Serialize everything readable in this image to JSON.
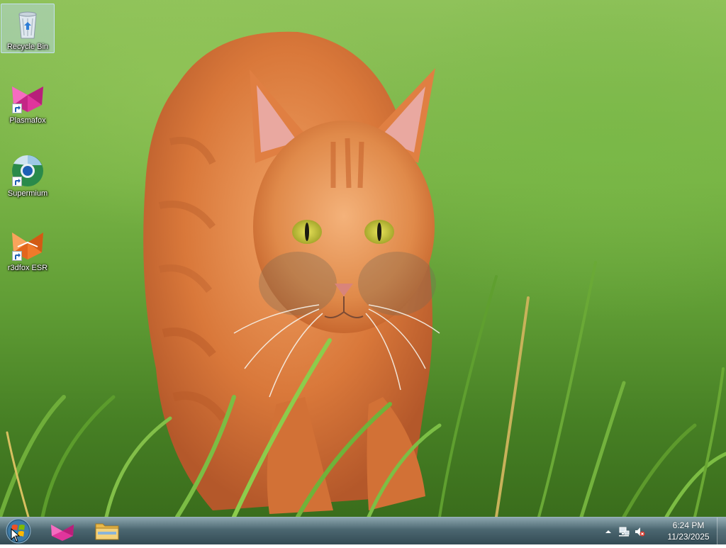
{
  "desktop": {
    "icons": [
      {
        "label": "Recycle Bin",
        "icon": "recycle-bin-icon",
        "selected": true
      },
      {
        "label": "Plasmafox",
        "icon": "plasmafox-icon",
        "shortcut": true
      },
      {
        "label": "Supermium",
        "icon": "supermium-icon",
        "shortcut": true
      },
      {
        "label": "r3dfox ESR",
        "icon": "r3dfox-icon",
        "shortcut": true
      }
    ],
    "wallpaper": "orange-tabby-cat-in-grass"
  },
  "taskbar": {
    "start_button": "windows-start-orb",
    "pinned": [
      {
        "name": "plasmafox",
        "icon": "plasmafox-icon"
      },
      {
        "name": "file-explorer",
        "icon": "folder-icon"
      }
    ],
    "tray": {
      "show_hidden_icon": "chevron-up-icon",
      "network_icon": "network-icon",
      "volume_icon": "volume-muted-icon",
      "time": "6:24 PM",
      "date": "11/23/2025"
    }
  },
  "colors": {
    "taskbar": "#3c5a64",
    "selection": "#bedcf5",
    "plasmafox_pink": "#e0359c",
    "r3dfox_orange": "#f07a2a"
  }
}
